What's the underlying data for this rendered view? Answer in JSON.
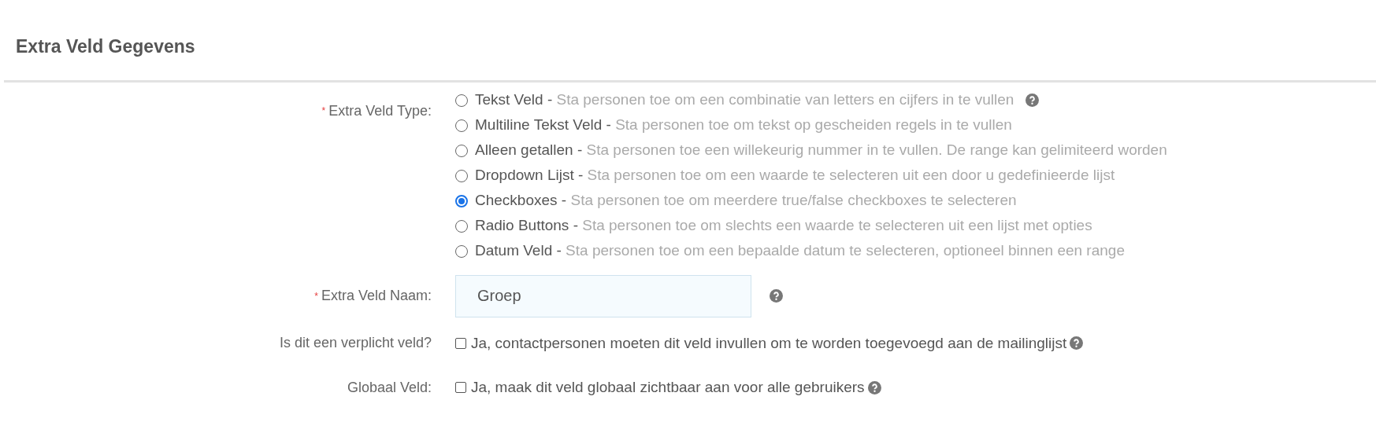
{
  "section_title": "Extra Veld Gegevens",
  "field_type": {
    "required_mark": "*",
    "label": "Extra Veld Type:",
    "options": [
      {
        "name": "Tekst Veld -",
        "description": "Sta personen toe om een combinatie van letters en cijfers in te vullen",
        "selected": false,
        "help": true
      },
      {
        "name": "Multiline Tekst Veld -",
        "description": "Sta personen toe om tekst op gescheiden regels in te vullen",
        "selected": false,
        "help": false
      },
      {
        "name": "Alleen getallen -",
        "description": "Sta personen toe een willekeurig nummer in te vullen. De range kan gelimiteerd worden",
        "selected": false,
        "help": false
      },
      {
        "name": "Dropdown Lijst -",
        "description": "Sta personen toe om een waarde te selecteren uit een door u gedefinieerde lijst",
        "selected": false,
        "help": false
      },
      {
        "name": "Checkboxes -",
        "description": "Sta personen toe om meerdere true/false checkboxes te selecteren",
        "selected": true,
        "help": false
      },
      {
        "name": "Radio Buttons -",
        "description": "Sta personen toe om slechts een waarde te selecteren uit een lijst met opties",
        "selected": false,
        "help": false
      },
      {
        "name": "Datum Veld -",
        "description": "Sta personen toe om een bepaalde datum te selecteren, optioneel binnen een range",
        "selected": false,
        "help": false
      }
    ]
  },
  "field_name": {
    "required_mark": "*",
    "label": "Extra Veld Naam:",
    "value": "Groep"
  },
  "checkbox_rows": [
    {
      "label": "Is dit een verplicht veld?",
      "text": "Ja, contactpersonen moeten dit veld invullen om te worden toegevoegd aan de mailinglijst",
      "checked": false
    },
    {
      "label": "Globaal Veld:",
      "text": "Ja, maak dit veld globaal zichtbaar aan voor alle gebruikers",
      "checked": false
    }
  ]
}
